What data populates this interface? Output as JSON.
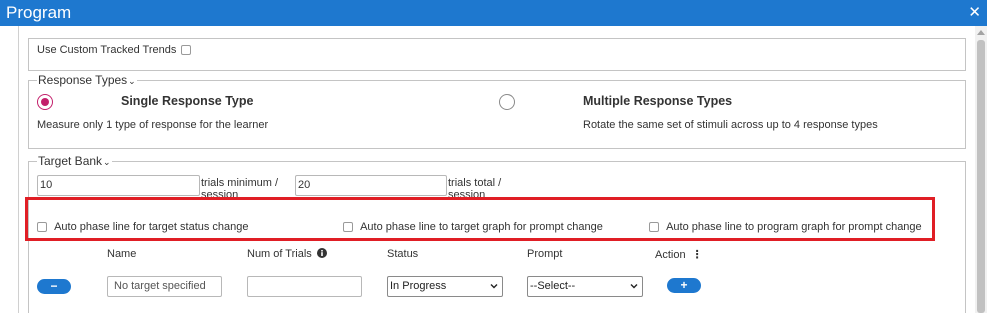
{
  "window": {
    "title": "Program",
    "close_icon": "close-icon"
  },
  "tracked_trends": {
    "label": "Use Custom Tracked Trends"
  },
  "response_types": {
    "legend": "Response Types",
    "single": {
      "title": "Single Response Type",
      "description": "Measure only 1 type of response for the learner",
      "selected": true
    },
    "multiple": {
      "title": "Multiple Response Types",
      "description": "Rotate the same set of stimuli across up to 4 response types",
      "selected": false
    }
  },
  "target_bank": {
    "legend": "Target Bank",
    "trials_min_value": "10",
    "trials_min_label": "trials minimum / session",
    "trials_total_value": "20",
    "trials_total_label": "trials total / session",
    "auto_phase": [
      "Auto phase line for target status change",
      "Auto phase line to target graph for prompt change",
      "Auto phase line to program graph for prompt change"
    ],
    "columns": {
      "name": "Name",
      "trials": "Num of Trials",
      "status": "Status",
      "prompt": "Prompt",
      "action": "Action"
    },
    "row": {
      "remove_label": "−",
      "name_placeholder": "No target specified",
      "trials_value": "",
      "status_value": "In Progress",
      "prompt_value": "--Select--",
      "add_label": "+"
    }
  },
  "colors": {
    "accent": "#1e78cf",
    "radio_selected": "#c3206b",
    "highlight": "#e01e25"
  }
}
